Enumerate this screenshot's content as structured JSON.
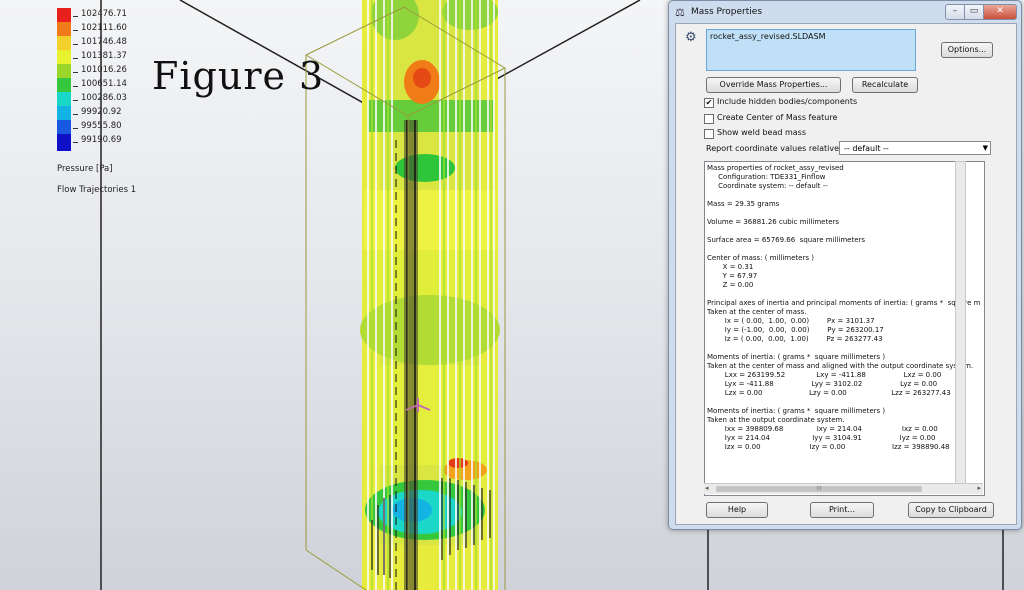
{
  "legend": {
    "values": [
      "102476.71",
      "102111.60",
      "101746.48",
      "101381.37",
      "101016.26",
      "100651.14",
      "100286.03",
      "99920.92",
      "99555.80",
      "99190.69"
    ],
    "colors": [
      "#e8201b",
      "#f07b18",
      "#f3d12a",
      "#e9f22f",
      "#9ad72a",
      "#35c83d",
      "#1bd7c7",
      "#13b3e3",
      "#1958e0",
      "#1010c8"
    ],
    "title": "Pressure [Pa]",
    "subtitle": "Flow Trajectories 1"
  },
  "figure_label": "Figure 3",
  "dialog": {
    "title": "Mass Properties",
    "window_buttons": {
      "minimize": "–",
      "maximize": "▭",
      "close": "✕"
    },
    "file_name": "rocket_assy_revised.SLDASM",
    "options_button": "Options...",
    "override_button": "Override Mass Properties...",
    "recalculate_button": "Recalculate",
    "checkboxes": [
      {
        "label": "Include hidden bodies/components",
        "checked": "✔"
      },
      {
        "label": "Create Center of Mass feature",
        "checked": ""
      },
      {
        "label": "Show weld bead mass",
        "checked": ""
      }
    ],
    "coord_label": "Report coordinate values relative to:",
    "coord_value": "-- default --",
    "results_lines": [
      "Mass properties of rocket_assy_revised",
      "     Configuration: TDE331_Finflow",
      "     Coordinate system: -- default --",
      "",
      "Mass = 29.35 grams",
      "",
      "Volume = 36881.26 cubic millimeters",
      "",
      "Surface area = 65769.66  square millimeters",
      "",
      "Center of mass: ( millimeters )",
      "       X = 0.31",
      "       Y = 67.97",
      "       Z = 0.00",
      "",
      "Principal axes of inertia and principal moments of inertia: ( grams *  square m",
      "Taken at the center of mass.",
      "        Ix = ( 0.00,  1.00,  0.00)        Px = 3101.37",
      "        Iy = (-1.00,  0.00,  0.00)        Py = 263200.17",
      "        Iz = ( 0.00,  0.00,  1.00)        Pz = 263277.43",
      "",
      "Moments of inertia: ( grams *  square millimeters )",
      "Taken at the center of mass and aligned with the output coordinate system.",
      "        Lxx = 263199.52              Lxy = -411.88                 Lxz = 0.00",
      "        Lyx = -411.88                 Lyy = 3102.02                 Lyz = 0.00",
      "        Lzx = 0.00                     Lzy = 0.00                    Lzz = 263277.43",
      "",
      "Moments of inertia: ( grams *  square millimeters )",
      "Taken at the output coordinate system.",
      "        Ixx = 398809.68               Ixy = 214.04                  Ixz = 0.00",
      "        Iyx = 214.04                   Iyy = 3104.91                 Iyz = 0.00",
      "        Izx = 0.00                      Izy = 0.00                     Izz = 398890.48"
    ],
    "scroll_thumb": "III",
    "help_button": "Help",
    "print_button": "Print...",
    "clipboard_button": "Copy to Clipboard"
  }
}
